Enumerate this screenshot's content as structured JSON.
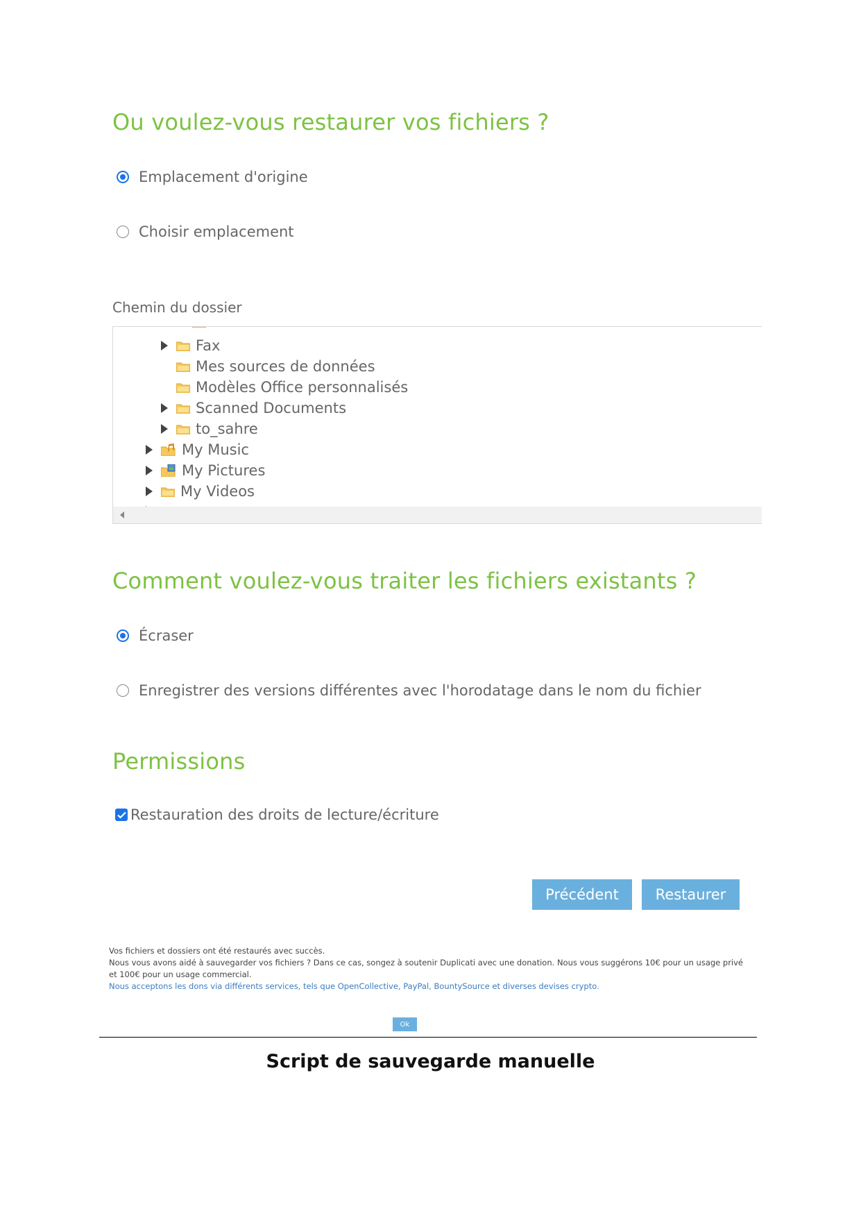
{
  "section_location": {
    "title": "Ou voulez-vous restaurer vos fichiers ?",
    "options": [
      {
        "label": "Emplacement d'origine",
        "selected": true
      },
      {
        "label": "Choisir emplacement",
        "selected": false
      }
    ],
    "folder_path_label": "Chemin du dossier",
    "tree": [
      {
        "label": "Fax",
        "expandable": true,
        "icon": "folder-icon"
      },
      {
        "label": "Mes sources de données",
        "expandable": false,
        "icon": "folder-icon"
      },
      {
        "label": "Modèles Office personnalisés",
        "expandable": false,
        "icon": "folder-icon"
      },
      {
        "label": "Scanned Documents",
        "expandable": true,
        "icon": "folder-icon"
      },
      {
        "label": "to_sahre",
        "expandable": true,
        "icon": "folder-icon"
      },
      {
        "label": "My Music",
        "expandable": true,
        "icon": "music-folder-icon"
      },
      {
        "label": "My Pictures",
        "expandable": true,
        "icon": "pictures-folder-icon"
      },
      {
        "label": "My Videos",
        "expandable": true,
        "icon": "folder-icon"
      }
    ]
  },
  "section_existing": {
    "title": "Comment voulez-vous traiter les fichiers existants ?",
    "options": [
      {
        "label": "Écraser",
        "selected": true
      },
      {
        "label": "Enregistrer des versions différentes avec l'horodatage dans le nom du fichier",
        "selected": false
      }
    ]
  },
  "section_permissions": {
    "title": "Permissions",
    "checkbox_label": "Restauration des droits de lecture/écriture",
    "checked": true
  },
  "buttons": {
    "previous": "Précédent",
    "restore": "Restaurer"
  },
  "notice": {
    "line1": "Vos fichiers et dossiers ont été restaurés avec succès.",
    "line2": "Nous vous avons aidé à sauvegarder vos fichiers ? Dans ce cas, songez à soutenir Duplicati avec une donation. Nous vous suggérons 10€ pour un usage privé",
    "line3": "et 100€ pour un usage commercial.",
    "line4": "Nous acceptons les dons via différents services, tels que OpenCollective, PayPal, BountySource et diverses devises crypto.",
    "ok": "Ok"
  },
  "caption": "Script de sauvegarde manuelle",
  "colors": {
    "heading_green": "#7dc242",
    "button_blue": "#6ab0de",
    "radio_blue": "#1a73e8"
  }
}
